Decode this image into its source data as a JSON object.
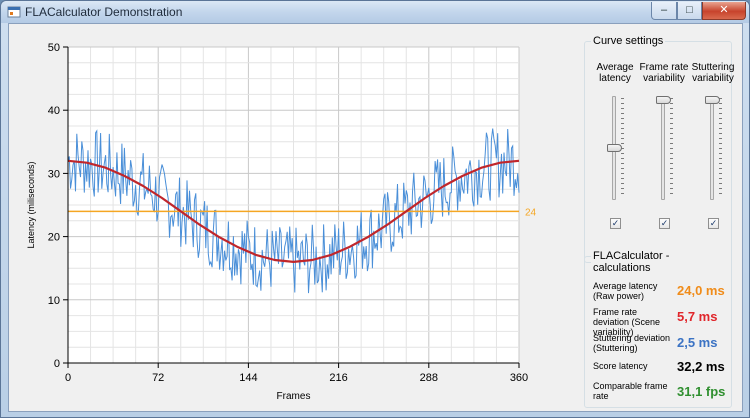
{
  "window": {
    "title": "FLACalculator Demonstration",
    "controls": {
      "minimize": "–",
      "maximize": "□",
      "close": "✕"
    }
  },
  "chart_data": {
    "type": "line",
    "xlabel": "Frames",
    "ylabel": "Latency (miliseconds)",
    "xlim": [
      0,
      360
    ],
    "ylim": [
      0,
      50
    ],
    "xticks": [
      "0",
      "72",
      "144",
      "216",
      "288",
      "360"
    ],
    "yticks": [
      "0",
      "10",
      "20",
      "30",
      "40",
      "50"
    ],
    "grid": true,
    "average_line": {
      "value": 24,
      "label": "24",
      "color": "#f5a623"
    },
    "series": [
      {
        "kind": "smooth-curve",
        "color": "#c0262b",
        "x": [
          0,
          15,
          30,
          45,
          60,
          75,
          90,
          105,
          120,
          135,
          150,
          165,
          180,
          195,
          210,
          225,
          240,
          255,
          270,
          285,
          300,
          315,
          330,
          345,
          360
        ],
        "values": [
          32.0,
          31.7,
          30.9,
          29.6,
          28.0,
          26.1,
          24.0,
          21.9,
          20.0,
          18.4,
          17.1,
          16.3,
          16.0,
          16.3,
          17.1,
          18.4,
          20.0,
          21.9,
          24.0,
          26.1,
          28.0,
          29.6,
          30.9,
          31.7,
          32.0
        ]
      },
      {
        "kind": "noisy-frames",
        "color": "#4a8fd8",
        "noise_amplitude": 5.7,
        "frame_count": 361
      }
    ]
  },
  "curve_settings": {
    "title": "Curve settings",
    "columns": [
      {
        "label": "Average latency",
        "level": 0.5,
        "checked": true
      },
      {
        "label": "Frame rate variability",
        "level": 0.0,
        "checked": true
      },
      {
        "label": "Stuttering variability",
        "level": 0.0,
        "checked": true
      }
    ]
  },
  "calculations": {
    "title": "FLACalculator - calculations",
    "rows": [
      {
        "label": "Average latency (Raw power)",
        "value": "24,0 ms",
        "color": "#f08c1a"
      },
      {
        "label": "Frame rate deviation (Scene variability)",
        "value": "5,7 ms",
        "color": "#e0262b"
      },
      {
        "label": "Stuttering deviation (Stuttering)",
        "value": "2,5 ms",
        "color": "#3b73c4"
      },
      {
        "label": "Score latency",
        "value": "32,2 ms",
        "color": "#000000"
      },
      {
        "label": "Comparable frame rate",
        "value": "31,1 fps",
        "color": "#2f8f2f"
      }
    ]
  }
}
